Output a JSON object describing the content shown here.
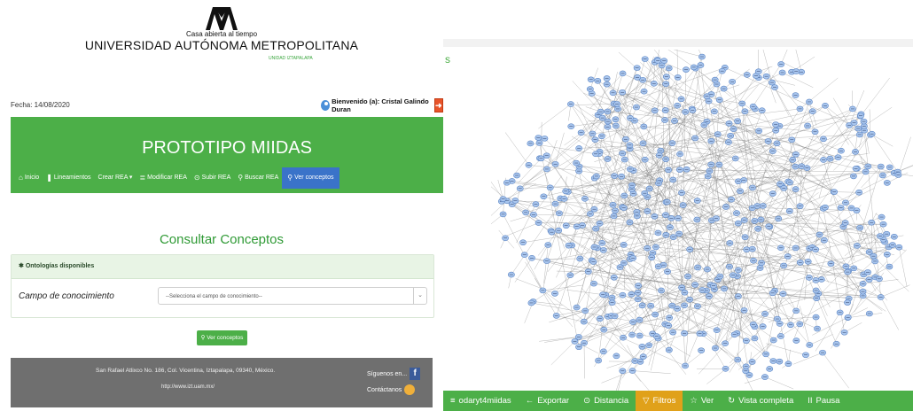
{
  "university": {
    "tagline": "Casa abierta al tiempo",
    "name": "UNIVERSIDAD AUTÓNOMA METROPOLITANA",
    "unit": "UNIDAD IZTAPALAPA"
  },
  "fecha": "Fecha: 14/08/2020",
  "user": {
    "welcome": "Bienvenido (a):  Cristal Galindo Duran"
  },
  "app_title": "PROTOTIPO MIIDAS",
  "nav": [
    {
      "icon": "home-icon",
      "glyph": "⌂",
      "label": "Inicio"
    },
    {
      "icon": "bookmark-icon",
      "glyph": "❚",
      "label": "Lineamientos"
    },
    {
      "icon": "",
      "glyph": "",
      "label": "Crear REA ▾"
    },
    {
      "icon": "list-icon",
      "glyph": "≣",
      "label": "Modificar REA"
    },
    {
      "icon": "upload-icon",
      "glyph": "⊙",
      "label": "Subir REA"
    },
    {
      "icon": "search-icon",
      "glyph": "⚲",
      "label": "Buscar REA"
    },
    {
      "icon": "zoom-icon",
      "glyph": "⚲",
      "label": "Ver conceptos"
    }
  ],
  "page_title": "Consultar Conceptos",
  "ontologies": {
    "heading": "Ontologías disponibles",
    "field_label": "Campo de conocimiento",
    "select_value": "--Selecciona el campo de conocimiento--"
  },
  "ver_button": "Ver conceptos",
  "footer": {
    "address": "San Rafael Atlixco No. 186, Col. Vicentina, Iztapalapa, 09340, México.",
    "url": "http://www.izt.uam.mx/",
    "follow": "Síguenos en...",
    "contact": "Contáctanos"
  },
  "right": {
    "edge_text": "s",
    "toolbar": [
      {
        "glyph": "≡",
        "label": "odaryt4miidas",
        "active": false
      },
      {
        "glyph": "←",
        "label": "Exportar",
        "active": false
      },
      {
        "glyph": "⊙",
        "label": "Distancia",
        "active": false
      },
      {
        "glyph": "▽",
        "label": "Filtros",
        "active": true
      },
      {
        "glyph": "☆",
        "label": "Ver",
        "active": false
      },
      {
        "glyph": "↻",
        "label": "Vista completa",
        "active": false
      },
      {
        "glyph": "II",
        "label": "Pausa",
        "active": false
      }
    ]
  },
  "colors": {
    "green": "#4caf48",
    "blue_active": "#3a73c9",
    "orange_active": "#e0a11a",
    "node_fill": "#a9c6ee",
    "node_stroke": "#5d86c4"
  }
}
